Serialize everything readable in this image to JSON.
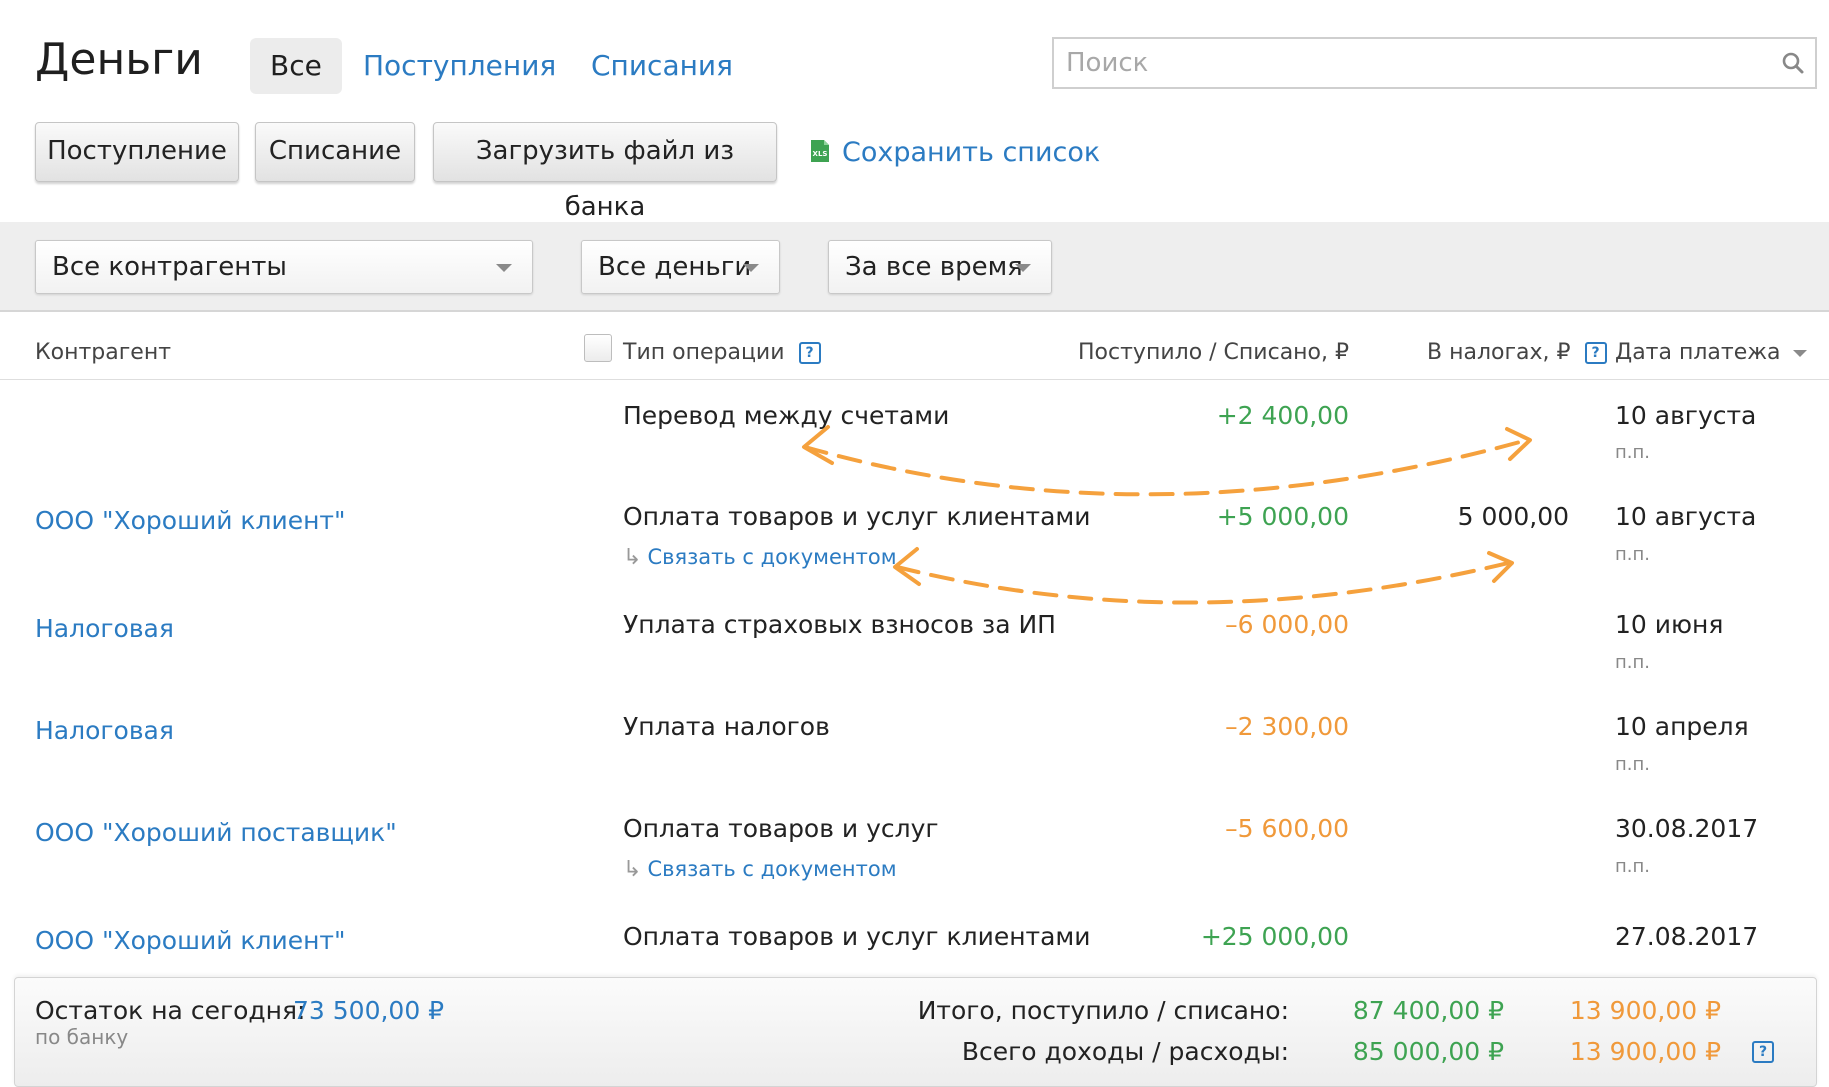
{
  "header": {
    "title": "Деньги",
    "tabs": [
      {
        "label": "Все",
        "active": true
      },
      {
        "label": "Поступления",
        "active": false
      },
      {
        "label": "Списания",
        "active": false
      }
    ],
    "search_placeholder": "Поиск"
  },
  "actions": {
    "income_label": "Поступление",
    "expense_label": "Списание",
    "upload_label": "Загрузить файл из банка",
    "save_list_label": "Сохранить список"
  },
  "filters": {
    "counterparty": "Все контрагенты",
    "money": "Все деньги",
    "period": "За все время"
  },
  "table": {
    "columns": {
      "counterparty": "Контрагент",
      "type": "Тип операции",
      "amount": "Поступило / Списано, ₽",
      "tax": "В налогах, ₽",
      "date": "Дата платежа"
    },
    "link_doc_label": "Связать с документом",
    "rows": [
      {
        "counterparty": "",
        "type": "Перевод между счетами",
        "amount": "+2 400,00",
        "tax": "",
        "date": "10 августа",
        "doc": "п.п."
      },
      {
        "counterparty": "ООО \"Хороший клиент\"",
        "type": "Оплата товаров и услуг клиентами",
        "amount": "+5 000,00",
        "tax": "5 000,00",
        "date": "10 августа",
        "doc": "п.п."
      },
      {
        "counterparty": "Налоговая",
        "type": "Уплата страховых взносов за ИП",
        "amount": "–6 000,00",
        "tax": "",
        "date": "10 июня",
        "doc": "п.п."
      },
      {
        "counterparty": "Налоговая",
        "type": "Уплата налогов",
        "amount": "–2 300,00",
        "tax": "",
        "date": "10 апреля",
        "doc": "п.п."
      },
      {
        "counterparty": "ООО \"Хороший поставщик\"",
        "type": "Оплата товаров и услуг",
        "amount": "–5 600,00",
        "tax": "",
        "date": "30.08.2017",
        "doc": "п.п."
      },
      {
        "counterparty": "ООО \"Хороший клиент\"",
        "type": "Оплата товаров и услуг клиентами",
        "amount": "+25 000,00",
        "tax": "",
        "date": "27.08.2017",
        "doc": ""
      }
    ]
  },
  "footer": {
    "balance_label": "Остаток на сегодня:",
    "balance_value": "73 500,00 ₽",
    "balance_source": "по банку",
    "totals_label": "Итого, поступило / списано:",
    "totals_in": "87 400,00 ₽",
    "totals_out": "13 900,00 ₽",
    "income_label": "Всего доходы / расходы:",
    "income_in": "85 000,00 ₽",
    "income_out": "13 900,00 ₽"
  },
  "colors": {
    "link": "#2b7bc2",
    "positive": "#3ea352",
    "negative": "#f0993a",
    "annotation": "#f5a13d"
  },
  "icons": [
    "search-icon",
    "xls-icon",
    "help-icon",
    "chevron-down-icon",
    "sort-down-icon"
  ]
}
